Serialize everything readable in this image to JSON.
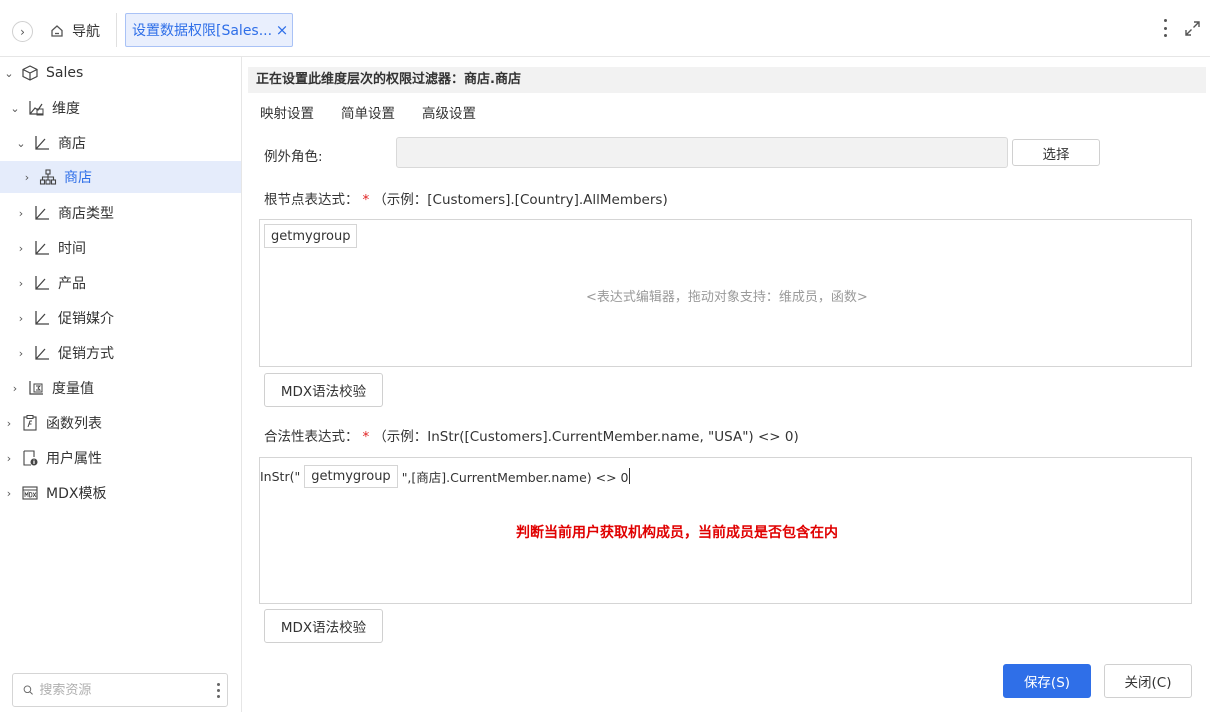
{
  "topbar": {
    "nav_label": "导航",
    "tab_label": "设置数据权限[Sales...",
    "tab_close": "×"
  },
  "sidebar": {
    "items": [
      {
        "label": "Sales",
        "icon": "cube-icon",
        "expanded": true
      },
      {
        "label": "维度",
        "icon": "dimension-icon",
        "expanded": true
      },
      {
        "label": "商店",
        "icon": "hierarchy-icon",
        "expanded": true
      },
      {
        "label": "商店",
        "icon": "org-tree-icon",
        "expanded": false,
        "selected": true
      },
      {
        "label": "商店类型",
        "icon": "hierarchy-icon",
        "expanded": false
      },
      {
        "label": "时间",
        "icon": "hierarchy-icon",
        "expanded": false
      },
      {
        "label": "产品",
        "icon": "hierarchy-icon",
        "expanded": false
      },
      {
        "label": "促销媒介",
        "icon": "hierarchy-icon",
        "expanded": false
      },
      {
        "label": "促销方式",
        "icon": "hierarchy-icon",
        "expanded": false
      },
      {
        "label": "度量值",
        "icon": "measure-icon",
        "expanded": false
      },
      {
        "label": "函数列表",
        "icon": "function-list-icon",
        "expanded": false
      },
      {
        "label": "用户属性",
        "icon": "user-attribute-icon",
        "expanded": false
      },
      {
        "label": "MDX模板",
        "icon": "mdx-template-icon",
        "expanded": false
      }
    ],
    "search_placeholder": "搜索资源"
  },
  "main": {
    "filter_info": "正在设置此维度层次的权限过滤器：商店.商店",
    "subtabs": [
      "映射设置",
      "简单设置",
      "高级设置"
    ],
    "exception_role_label": "例外角色:",
    "select_button": "选择",
    "root_expr_label": "根节点表达式：",
    "required_mark": "*",
    "root_expr_example": "（示例：[Customers].[Country].AllMembers)",
    "root_expr_chip": "getmygroup",
    "root_expr_placeholder": "<表达式编辑器，拖动对象支持：维成员，函数>",
    "mdx_check_button": "MDX语法校验",
    "validity_expr_label": "合法性表达式：",
    "validity_expr_example": "（示例：InStr([Customers].CurrentMember.name, \"USA\") <> 0)",
    "validity_expr_prefix": "InStr(\"",
    "validity_expr_chip": "getmygroup",
    "validity_expr_suffix": "\",[商店].CurrentMember.name) <> 0",
    "annotation": "判断当前用户获取机构成员，当前成员是否包含在内",
    "save_button": "保存(S)",
    "close_button": "关闭(C)"
  },
  "colors": {
    "accent": "#2f6fe8",
    "selected_bg": "#e5ecfb",
    "annotation": "#e00000",
    "required": "#e02020"
  }
}
